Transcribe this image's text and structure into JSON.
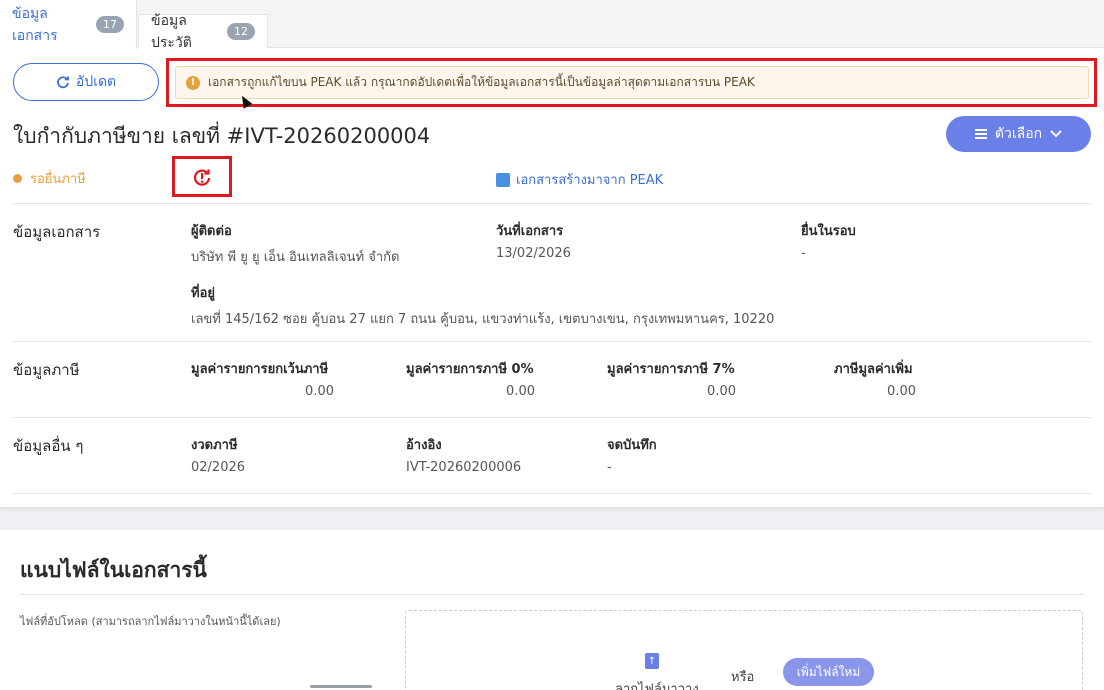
{
  "tabs": [
    {
      "label": "ข้อมูลเอกสาร",
      "count": "17"
    },
    {
      "label": "ข้อมูลประวัติ",
      "count": "12"
    }
  ],
  "toolbar": {
    "update_label": "อัปเดต"
  },
  "alert": {
    "text": "เอกสารถูกแก้ไขบน PEAK แล้ว กรุณากดอัปเดตเพื่อให้ข้อมูลเอกสารนี้เป็นข้อมูลล่าสุดตามเอกสารบน PEAK"
  },
  "document": {
    "title": "ใบกำกับภาษีขาย เลขที่ #IVT-20260200004",
    "options_label": "ตัวเลือก",
    "status": "รอยื่นภาษี",
    "source": "เอกสารสร้างมาจาก PEAK"
  },
  "doc_info": {
    "section": "ข้อมูลเอกสาร",
    "contact_label": "ผู้ติดต่อ",
    "contact_value": "บริษัท พี ยู ยู เอ็น อินเทลลิเจนท์ จำกัด",
    "date_label": "วันที่เอกสาร",
    "date_value": "13/02/2026",
    "round_label": "ยื่นในรอบ",
    "round_value": "-",
    "address_label": "ที่อยู่",
    "address_value": "เลขที่ 145/162 ซอย คู้บอน 27 แยก 7 ถนน คู้บอน, แขวงท่าแร้ง, เขตบางเขน, กรุงเทพมหานคร, 10220"
  },
  "tax_info": {
    "section": "ข้อมูลภาษี",
    "exempt_label": "มูลค่ารายการยกเว้นภาษี",
    "exempt_value": "0.00",
    "zero_label": "มูลค่ารายการภาษี 0%",
    "zero_value": "0.00",
    "seven_label": "มูลค่ารายการภาษี 7%",
    "seven_value": "0.00",
    "vat_label": "ภาษีมูลค่าเพิ่ม",
    "vat_value": "0.00"
  },
  "other_info": {
    "section": "ข้อมูลอื่น ๆ",
    "period_label": "งวดภาษี",
    "period_value": "02/2026",
    "ref_label": "อ้างอิง",
    "ref_value": "IVT-20260200006",
    "note_label": "จดบันทึก",
    "note_value": "-"
  },
  "attachments": {
    "title": "แนบไฟล์ในเอกสารนี้",
    "uploaded_label": "ไฟล์ที่อัปโหลด (สามารถลากไฟล์มาวางในหน้านี้ได้เลย)",
    "drop_text": "ลากไฟล์มาวาง",
    "or_text": "หรือ",
    "add_button": "เพิ่มไฟล์ใหม่"
  },
  "colors": {
    "accent": "#3b6fd6",
    "warning": "#e6a23c",
    "highlight": "#e0191e",
    "options_button": "#6a7fe8"
  }
}
